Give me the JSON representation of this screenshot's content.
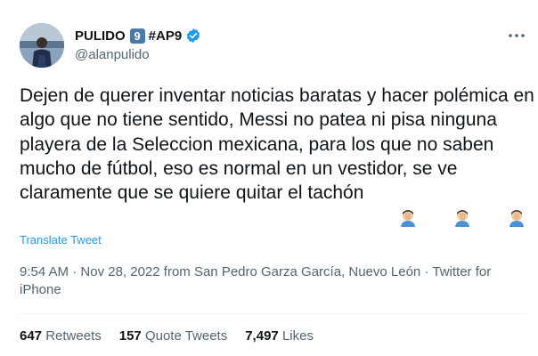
{
  "user": {
    "name": "PULIDO",
    "number_badge": "9",
    "tag": "#AP9",
    "handle": "@alanpulido"
  },
  "tweet": {
    "text": "Dejen de querer inventar noticias baratas y hacer polémica en algo que no tiene sentido, Messi no patea ni pisa ninguna playera de la Seleccion mexicana, para los que no saben mucho de fútbol, eso es normal en un vestidor, se ve claramente que se quiere quitar el tachón",
    "emojis": [
      "man-facepalming",
      "man-facepalming",
      "man-facepalming"
    ],
    "translate_label": "Translate Tweet"
  },
  "meta": {
    "time": "9:54 AM",
    "date": "Nov 28, 2022",
    "location": "from San Pedro Garza García, Nuevo León",
    "source": "Twitter for iPhone"
  },
  "stats": {
    "retweets_count": "647",
    "retweets_label": "Retweets",
    "quotes_count": "157",
    "quotes_label": "Quote Tweets",
    "likes_count": "7,497",
    "likes_label": "Likes"
  },
  "colors": {
    "link": "#1d9bf0",
    "secondary_text": "#536471",
    "verified": "#1d9bf0",
    "badge": "#4a7aa6"
  }
}
